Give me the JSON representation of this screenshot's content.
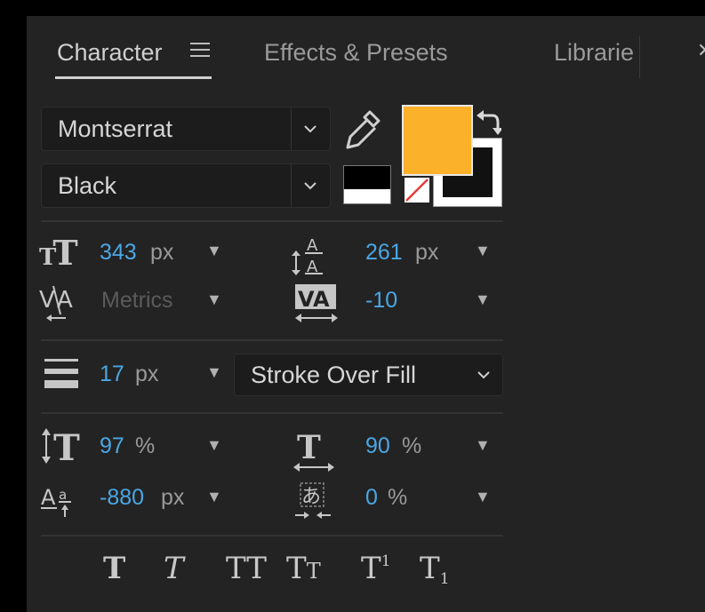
{
  "tabs": [
    {
      "label": "Character"
    },
    {
      "label": "Effects & Presets"
    },
    {
      "label": "Librarie"
    }
  ],
  "font": {
    "family": "Montserrat",
    "style": "Black"
  },
  "colors": {
    "fill": "#FCB12A",
    "stroke": "#FFFFFF",
    "accent_value": "#4AA7E4"
  },
  "size": {
    "value": "343",
    "unit": "px"
  },
  "leading": {
    "value": "261",
    "unit": "px"
  },
  "kerning": {
    "value": "Metrics"
  },
  "tracking": {
    "value": "-10"
  },
  "stroke": {
    "value": "17",
    "unit": "px",
    "mode": "Stroke Over Fill"
  },
  "vertical_scale": {
    "value": "97",
    "unit": "%"
  },
  "horizontal_scale": {
    "value": "90",
    "unit": "%"
  },
  "baseline_shift": {
    "value": "-880",
    "unit": "px"
  },
  "tsume": {
    "value": "0",
    "unit": "%"
  },
  "style_buttons": {
    "bold": "T",
    "italic": "T",
    "all_caps": "TT",
    "small_caps_big": "T",
    "small_caps_small": "T",
    "superscript_base": "T",
    "superscript_mark": "1",
    "subscript_base": "T",
    "subscript_mark": "1"
  }
}
